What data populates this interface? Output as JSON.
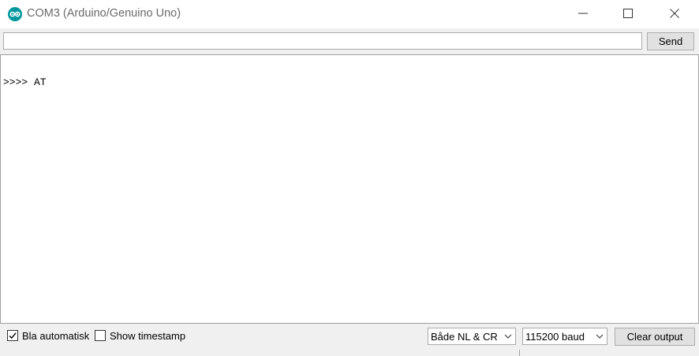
{
  "window": {
    "title": "COM3 (Arduino/Genuino Uno)",
    "icon": "arduino-logo-icon",
    "accent_color": "#00979c"
  },
  "controls": {
    "minimize_icon": "minimize-icon",
    "maximize_icon": "maximize-icon",
    "close_icon": "close-icon"
  },
  "input": {
    "value": "",
    "placeholder": ""
  },
  "send_button": {
    "label": "Send"
  },
  "output": {
    "lines": [
      ">>>> AT"
    ]
  },
  "statusbar": {
    "autoscroll": {
      "label": "Bla automatisk",
      "checked": true
    },
    "timestamp": {
      "label": "Show timestamp",
      "checked": false
    },
    "line_ending": {
      "selected": "Både NL & CR"
    },
    "baud_rate": {
      "selected": "115200 baud"
    },
    "clear_button": {
      "label": "Clear output"
    }
  }
}
